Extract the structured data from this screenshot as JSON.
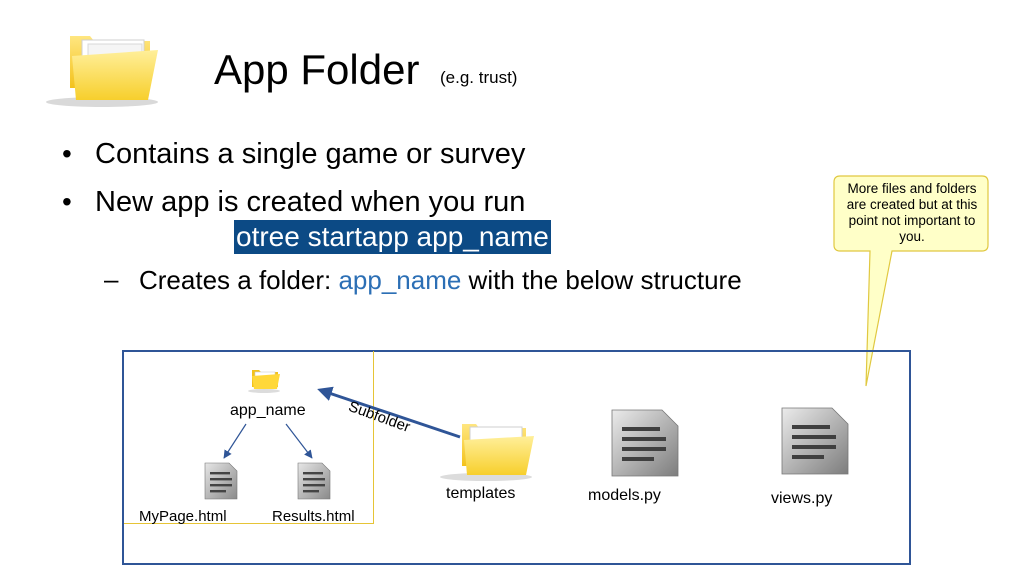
{
  "slide": {
    "title": "App Folder",
    "subtitle": "(e.g. trust)",
    "bullets": [
      "Contains a single game or survey",
      "New app is created when you run"
    ],
    "command": "otree startapp app_name",
    "sub_bullet": {
      "dash": "–",
      "prefix": "Creates a folder: ",
      "code": "app_name",
      "suffix": " with the below structure"
    },
    "callout": "More files and folders are created but at this point not important to you.",
    "diagram": {
      "app_folder_label": "app_name",
      "arrow_label": "Subfolder",
      "files": {
        "mypage": "MyPage.html",
        "results": "Results.html",
        "templates": "templates",
        "models": "models.py",
        "views": "views.py"
      }
    }
  },
  "colors": {
    "command_bg": "#0c4a85",
    "code_text": "#2c6fb5",
    "diagram_border": "#2f5597",
    "callout_fill": "#ffffc8",
    "callout_border": "#e0c840"
  },
  "icons": [
    "folder-icon",
    "document-icon",
    "arrow-icon"
  ]
}
